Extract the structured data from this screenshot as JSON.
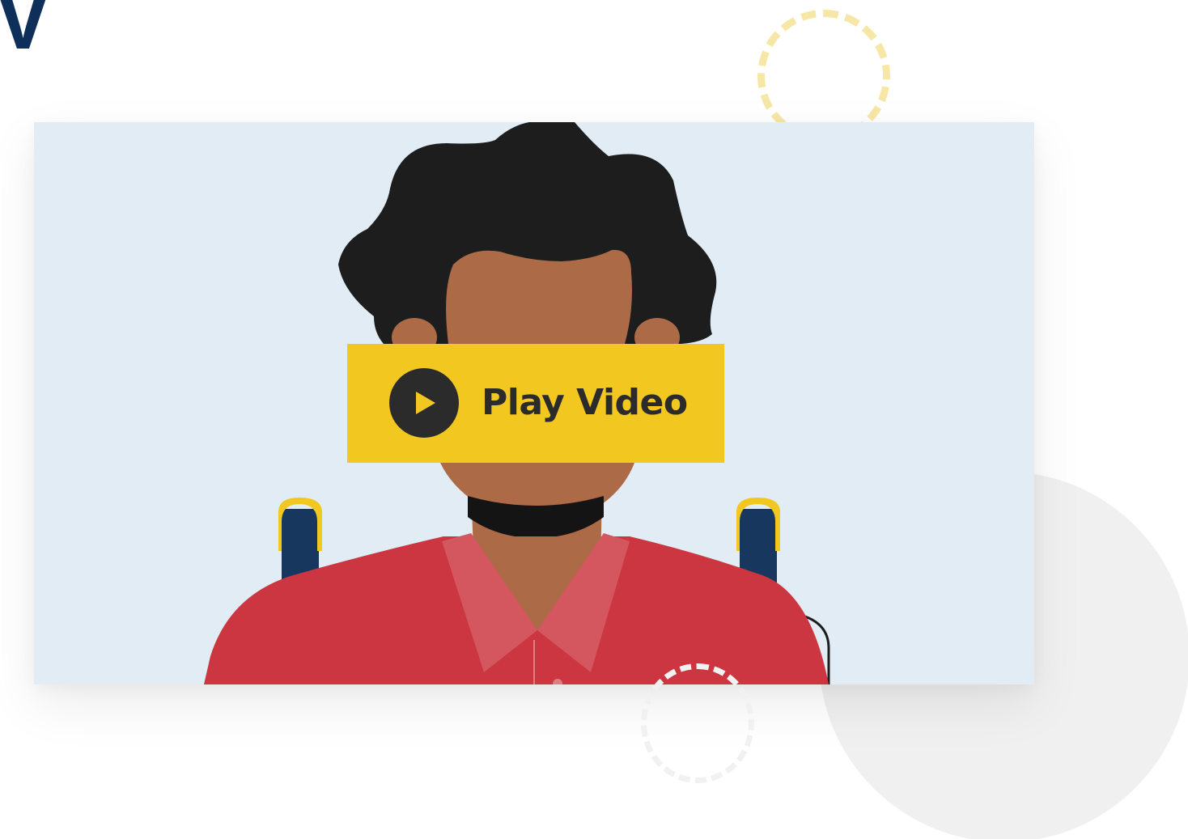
{
  "heading": {
    "fragment": "V"
  },
  "video": {
    "play_label": "Play Video",
    "play_icon": "play-icon"
  },
  "colors": {
    "heading": "#0e2f5a",
    "video_background": "#e1ecf4",
    "banner": "#f2c820",
    "play_circle": "#2b2b2b",
    "skin": "#ad6a47",
    "hair": "#1d1d1d",
    "shirt": "#cb3640",
    "collar": "#d4565e",
    "wheelchair_handle": "#17375f",
    "handle_cap": "#f2c820"
  }
}
